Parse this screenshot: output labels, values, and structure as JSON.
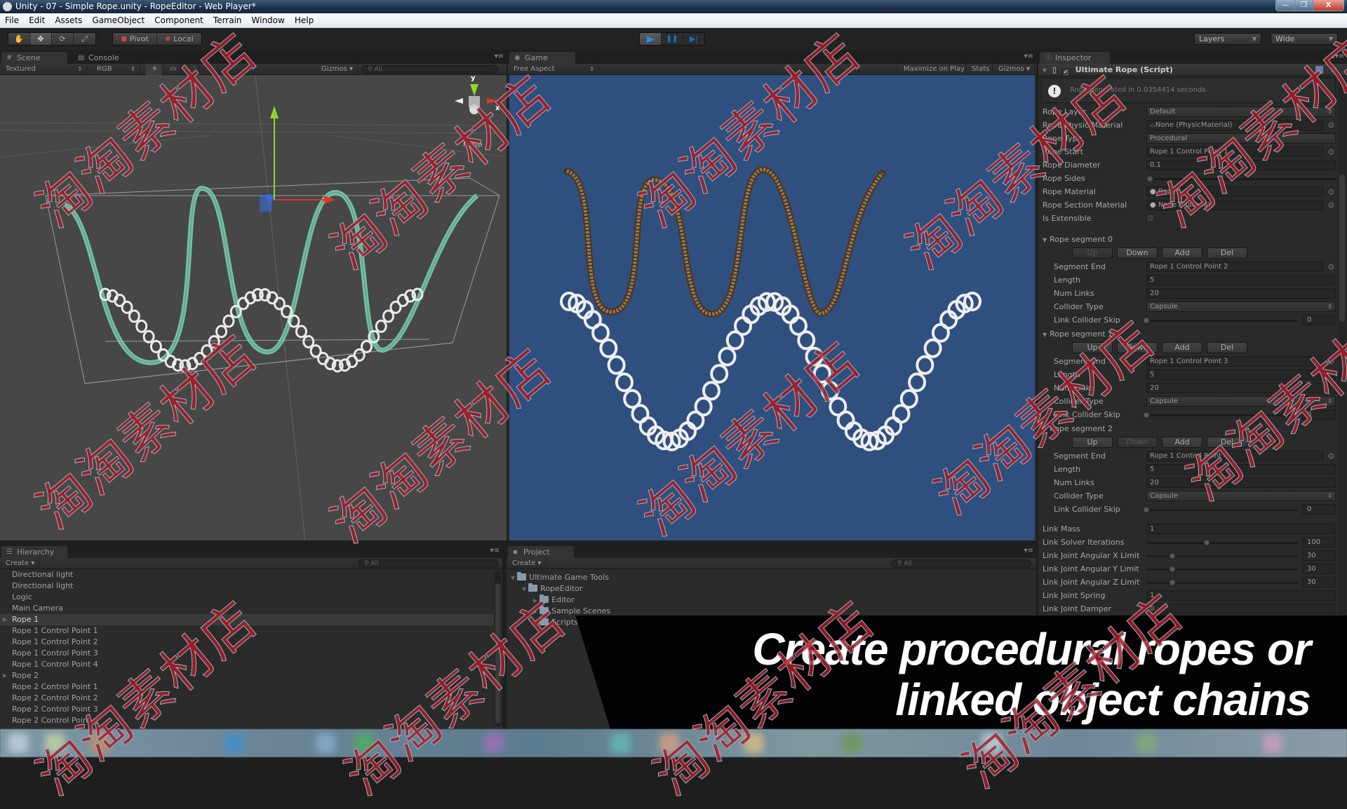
{
  "window": {
    "title": "Unity - 07 - Simple Rope.unity - RopeEditor - Web Player*",
    "controls": {
      "minimize": "—",
      "restore": "❐",
      "close": "X"
    }
  },
  "menu": [
    "File",
    "Edit",
    "Assets",
    "GameObject",
    "Component",
    "Terrain",
    "Window",
    "Help"
  ],
  "toolbar": {
    "transform_tools": [
      {
        "name": "hand-tool",
        "glyph": "✋"
      },
      {
        "name": "move-tool",
        "glyph": "✥"
      },
      {
        "name": "rotate-tool",
        "glyph": "⟳"
      },
      {
        "name": "scale-tool",
        "glyph": "⤢"
      }
    ],
    "pivot_label": "Pivot",
    "local_label": "Local",
    "play": {
      "play": "▶",
      "pause": "❚❚",
      "step": "▶|"
    },
    "layers_label": "Layers",
    "layout_label": "Wide"
  },
  "scene": {
    "tabs": {
      "scene": "Scene",
      "console": "Console"
    },
    "render_mode": "Textured",
    "color_mode": "RGB",
    "gizmos_label": "Gizmos",
    "search_placeholder": "All",
    "persp_label": "Persp",
    "axes": {
      "y": "y",
      "x": "x"
    }
  },
  "game": {
    "tab": "Game",
    "aspect": "Free Aspect",
    "maximize_label": "Maximize on Play",
    "stats_label": "Stats",
    "gizmos_label": "Gizmos"
  },
  "inspector": {
    "tab": "Inspector",
    "component_title": "Ultimate Rope (Script)",
    "help_message": "Rope generated in 0.0354414 seconds",
    "properties": [
      {
        "label": "Rope Layer",
        "value": "Default",
        "kind": "dropdown"
      },
      {
        "label": "Rope Physic Material",
        "value": "None (PhysicMaterial)",
        "kind": "object"
      },
      {
        "label": "Rope Type",
        "value": "Procedural",
        "kind": "dropdown"
      },
      {
        "label": "Rope Start",
        "value": "Rope 1 Control Point 1",
        "kind": "object"
      },
      {
        "label": "Rope Diameter",
        "value": "0.1",
        "kind": "field"
      },
      {
        "label": "Rope Sides",
        "value": "",
        "kind": "slider",
        "fraction": 0.02
      },
      {
        "label": "Rope Material",
        "value": "Rope",
        "kind": "object"
      },
      {
        "label": "Rope Section Material",
        "value": "None (Material)",
        "kind": "object"
      },
      {
        "label": "Is Extensible",
        "value": "",
        "kind": "checkbox",
        "checked": false
      }
    ],
    "segment_buttons": {
      "up": "Up",
      "down": "Down",
      "add": "Add",
      "del": "Del"
    },
    "segments": [
      {
        "title": "Rope segment 0",
        "up_enabled": false,
        "down_enabled": true,
        "segment_end": "Rope 1 Control Point 2",
        "length": "5",
        "num_links": "20",
        "collider_type": "Capsule",
        "link_collider_skip": "0"
      },
      {
        "title": "Rope segment 1",
        "up_enabled": true,
        "down_enabled": true,
        "segment_end": "Rope 1 Control Point 3",
        "length": "5",
        "num_links": "20",
        "collider_type": "Capsule",
        "link_collider_skip": "0"
      },
      {
        "title": "Rope segment 2",
        "up_enabled": true,
        "down_enabled": false,
        "segment_end": "Rope 1 Control Point 4",
        "length": "5",
        "num_links": "20",
        "collider_type": "Capsule",
        "link_collider_skip": "0"
      }
    ],
    "segment_labels": {
      "segment_end": "Segment End",
      "length": "Length",
      "num_links": "Num Links",
      "collider_type": "Collider Type",
      "link_collider_skip": "Link Collider Skip"
    },
    "link_properties": [
      {
        "label": "Link Mass",
        "value": "1",
        "kind": "field"
      },
      {
        "label": "Link Solver Iterations",
        "value": "100",
        "kind": "slider",
        "fraction": 0.4
      },
      {
        "label": "Link Joint Angular X Limit",
        "value": "30",
        "kind": "slider",
        "fraction": 0.17
      },
      {
        "label": "Link Joint Angular Y Limit",
        "value": "30",
        "kind": "slider",
        "fraction": 0.17
      },
      {
        "label": "Link Joint Angular Z Limit",
        "value": "30",
        "kind": "slider",
        "fraction": 0.17
      },
      {
        "label": "Link Joint Spring",
        "value": "1",
        "kind": "field"
      },
      {
        "label": "Link Joint Damper",
        "value": "0",
        "kind": "field"
      }
    ]
  },
  "hierarchy": {
    "tab": "Hierarchy",
    "create_label": "Create",
    "search_placeholder": "All",
    "items": [
      {
        "label": "Directional light",
        "expandable": false,
        "selected": false
      },
      {
        "label": "Directional light",
        "expandable": false,
        "selected": false
      },
      {
        "label": "Logic",
        "expandable": false,
        "selected": false
      },
      {
        "label": "Main Camera",
        "expandable": false,
        "selected": false
      },
      {
        "label": "Rope 1",
        "expandable": true,
        "selected": true
      },
      {
        "label": "Rope 1 Control Point 1",
        "expandable": false,
        "selected": false
      },
      {
        "label": "Rope 1 Control Point 2",
        "expandable": false,
        "selected": false
      },
      {
        "label": "Rope 1 Control Point 3",
        "expandable": false,
        "selected": false
      },
      {
        "label": "Rope 1 Control Point 4",
        "expandable": false,
        "selected": false
      },
      {
        "label": "Rope 2",
        "expandable": true,
        "selected": false
      },
      {
        "label": "Rope 2 Control Point 1",
        "expandable": false,
        "selected": false
      },
      {
        "label": "Rope 2 Control Point 2",
        "expandable": false,
        "selected": false
      },
      {
        "label": "Rope 2 Control Point 3",
        "expandable": false,
        "selected": false
      },
      {
        "label": "Rope 2 Control Point 4",
        "expandable": false,
        "selected": false
      }
    ]
  },
  "project": {
    "tab": "Project",
    "create_label": "Create",
    "search_placeholder": "All",
    "tree": [
      {
        "label": "Ultimate Game Tools",
        "depth": 0,
        "expanded": true
      },
      {
        "label": "RopeEditor",
        "depth": 1,
        "expanded": true
      },
      {
        "label": "Editor",
        "depth": 2,
        "expanded": false
      },
      {
        "label": "Sample Scenes",
        "depth": 2,
        "expanded": false
      },
      {
        "label": "Scripts",
        "depth": 2,
        "expanded": false
      }
    ]
  },
  "banner": {
    "line1": "Create procedural ropes or",
    "line2": "linked object chains"
  },
  "watermark": "淘淘素材店",
  "colors": {
    "game_background": "#2f4f7e",
    "scene_background": "#474747",
    "rope_wire": "#7fe3a0",
    "rope_brown": "#8a6a45",
    "chain": "#e8e8e8",
    "gizmo_x": "#e0382a",
    "gizmo_y": "#8fd62a",
    "gizmo_z": "#3a6ae0",
    "watermark": "#b01923"
  }
}
